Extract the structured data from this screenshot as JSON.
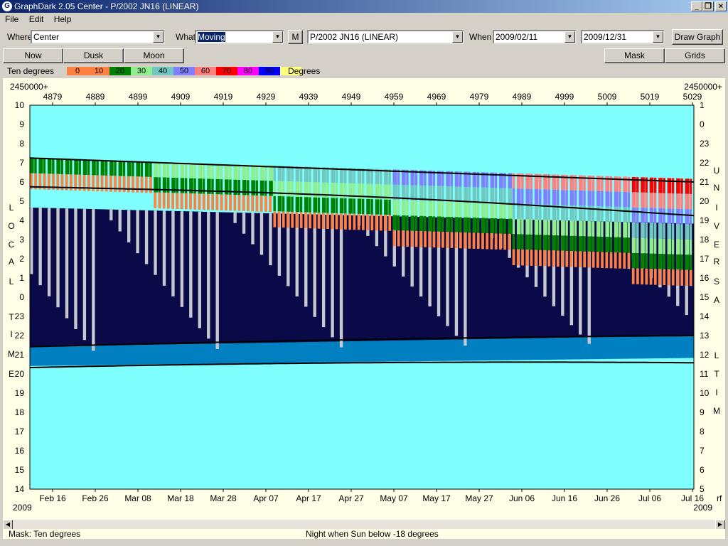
{
  "window": {
    "title": "GraphDark 2.05  Center  -  P/2002 JN16 (LINEAR)"
  },
  "menu": [
    "File",
    "Edit",
    "Help"
  ],
  "toolbar": {
    "where_label": "Where",
    "where_value": "Center",
    "what_label": "What",
    "what_value": "Moving",
    "m_label": "M",
    "object_value": "P/2002 JN16 (LINEAR)",
    "when_label": "When",
    "start_date": "2009/02/11",
    "end_date": "2009/12/31",
    "draw_label": "Draw Graph"
  },
  "buttons": {
    "now": "Now",
    "dusk": "Dusk",
    "moon": "Moon",
    "mask": "Mask",
    "grids": "Grids"
  },
  "legend": {
    "left_label": "Ten degrees",
    "right_label": "Degrees",
    "items": [
      {
        "label": "0",
        "color": "#ff8040"
      },
      {
        "label": "10",
        "color": "#ff8040"
      },
      {
        "label": "20",
        "color": "#008000"
      },
      {
        "label": "30",
        "color": "#90ee90"
      },
      {
        "label": "40",
        "color": "#70c8c0"
      },
      {
        "label": "50",
        "color": "#8080ff"
      },
      {
        "label": "60",
        "color": "#ff8080"
      },
      {
        "label": "70",
        "color": "#ff0000"
      },
      {
        "label": "80",
        "color": "#ff00ff"
      },
      {
        "label": "90",
        "color": "#0000ff"
      },
      {
        "label": "",
        "color": "#ffff80"
      }
    ]
  },
  "graph": {
    "jd_prefix": "2450000+",
    "jd_ticks": [
      "4879",
      "4889",
      "4899",
      "4909",
      "4919",
      "4929",
      "4939",
      "4949",
      "4959",
      "4969",
      "4979",
      "4989",
      "4999",
      "5009",
      "5019",
      "5029"
    ],
    "date_ticks": [
      "Feb 16",
      "Feb 26",
      "Mar 08",
      "Mar 18",
      "Mar 28",
      "Apr 07",
      "Apr 17",
      "Apr 27",
      "May 07",
      "May 17",
      "May 27",
      "Jun 06",
      "Jun 16",
      "Jun 26",
      "Jul 06",
      "Jul 16"
    ],
    "year_left": "2009",
    "year_right": "2009",
    "corner_right": "rf",
    "local_time_ticks": [
      "10",
      "9",
      "8",
      "7",
      "6",
      "5",
      "4",
      "3",
      "2",
      "1",
      "0",
      "23",
      "22",
      "21",
      "20",
      "19",
      "18",
      "17",
      "16",
      "15",
      "14"
    ],
    "ut_ticks": [
      "1",
      "0",
      "23",
      "22",
      "21",
      "20",
      "19",
      "18",
      "17",
      "16",
      "15",
      "14",
      "13",
      "12",
      "11",
      "10",
      "9",
      "8",
      "7",
      "6",
      "5"
    ],
    "left_axis_word": "LOCAL TIME",
    "right_axis_word": "UNIVERSAL TIME",
    "colors": {
      "sky": "#80ffff",
      "night": "#0a0a48",
      "twilight": "#0080c0",
      "moon": "#c8c8d0"
    }
  },
  "status": {
    "mask": "Mask:  Ten degrees",
    "night": "Night when Sun below -18 degrees"
  }
}
